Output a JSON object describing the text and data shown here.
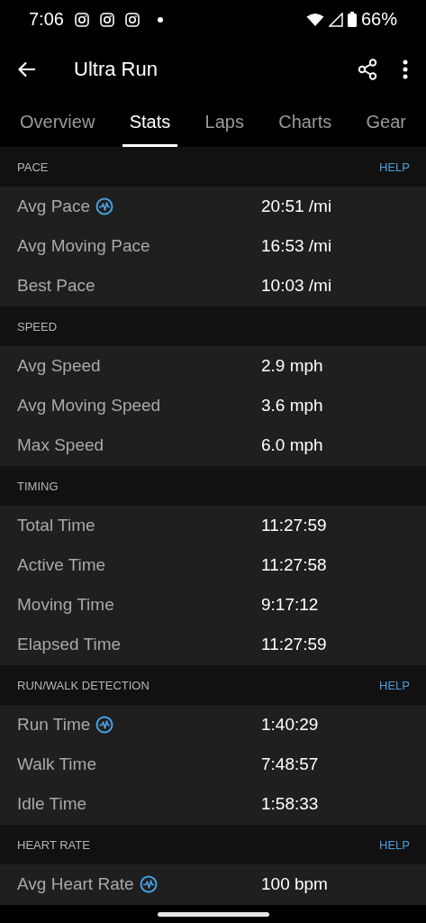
{
  "status_bar": {
    "time": "7:06",
    "notification_icons": [
      {
        "kind": "camera"
      },
      {
        "kind": "camera"
      },
      {
        "kind": "camera"
      }
    ],
    "battery": "66%"
  },
  "app_bar": {
    "title": "Ultra Run"
  },
  "tabs": [
    {
      "label": "Overview",
      "selected": false
    },
    {
      "label": "Stats",
      "selected": true
    },
    {
      "label": "Laps",
      "selected": false
    },
    {
      "label": "Charts",
      "selected": false
    },
    {
      "label": "Gear",
      "selected": false
    }
  ],
  "sections": [
    {
      "title": "PACE",
      "help": "HELP",
      "rows": [
        {
          "label": "Avg Pace",
          "info": true,
          "value": "20:51 /mi"
        },
        {
          "label": "Avg Moving Pace",
          "info": false,
          "value": "16:53 /mi"
        },
        {
          "label": "Best Pace",
          "info": false,
          "value": "10:03 /mi"
        }
      ]
    },
    {
      "title": "SPEED",
      "rows": [
        {
          "label": "Avg Speed",
          "info": false,
          "value": "2.9 mph"
        },
        {
          "label": "Avg Moving Speed",
          "info": false,
          "value": "3.6 mph"
        },
        {
          "label": "Max Speed",
          "info": false,
          "value": "6.0 mph"
        }
      ]
    },
    {
      "title": "TIMING",
      "rows": [
        {
          "label": "Total Time",
          "info": false,
          "value": "11:27:59"
        },
        {
          "label": "Active Time",
          "info": false,
          "value": "11:27:58"
        },
        {
          "label": "Moving Time",
          "info": false,
          "value": "9:17:12"
        },
        {
          "label": "Elapsed Time",
          "info": false,
          "value": "11:27:59"
        }
      ]
    },
    {
      "title": "RUN/WALK DETECTION",
      "help": "HELP",
      "rows": [
        {
          "label": "Run Time",
          "info": true,
          "value": "1:40:29"
        },
        {
          "label": "Walk Time",
          "info": false,
          "value": "7:48:57"
        },
        {
          "label": "Idle Time",
          "info": false,
          "value": "1:58:33"
        }
      ]
    },
    {
      "title": "HEART RATE",
      "help": "HELP",
      "rows": [
        {
          "label": "Avg Heart Rate",
          "info": true,
          "value": "100 bpm"
        }
      ]
    }
  ]
}
